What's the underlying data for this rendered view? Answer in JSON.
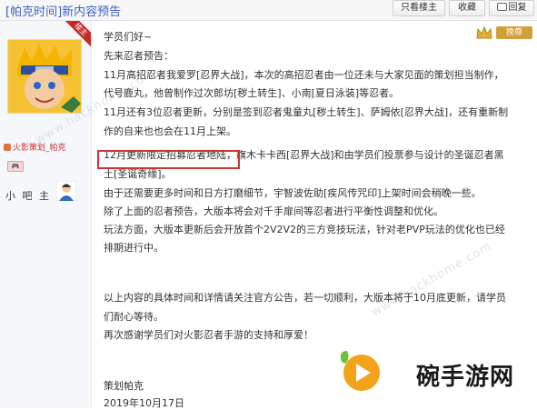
{
  "header": {
    "title": "[帕克时间]新内容预告",
    "only_op_label": "只看楼主",
    "favorite_label": "收藏",
    "reply_label": "回复"
  },
  "author": {
    "ribbon": "楼主",
    "name": "火影策划_帕克",
    "role": "小 吧 主"
  },
  "member_badge": "挽尊",
  "post": {
    "lines": [
      "学员们好~",
      "先来忍者预告：",
      "11月高招忍者我爱罗[忍界大战]，本次的高招忍者由一位还未与大家见面的策划担当制作，",
      "代号鹿丸，他曾制作过次郎坊[秽土转生]、小南[夏日泳装]等忍者。",
      "11月还有3位忍者更新，分别是签到忍者鬼童丸[秽土转生]、萨姆依[忍界大战]，还有重新制",
      "作的自来也也会在11月上架。",
      "12月更新限定招募忍者地陆，旗木卡卡西[忍界大战]和由学员们投票参与设计的圣诞忍者黑",
      "土[圣诞奇缘]。",
      "由于还需要更多时间和日方打磨细节，宇智波佐助[疾风传咒印]上架时间会稍晚一些。",
      "除了上面的忍者预告，大版本将会对千手扉间等忍者进行平衡性调整和优化。",
      "玩法方面，大版本更新后会开放首个2V2V2的三方竞技玩法，针对老PVP玩法的优化也已经",
      "排期进行中。",
      "以上内容的具体时间和详情请关注官方公告，若一切顺利，大版本将于10月底更新，请学员",
      "们耐心等待。",
      "再次感谢学员们对火影忍者手游的支持和厚爱！",
      "策划帕克",
      "2019年10月17日"
    ]
  },
  "watermark": "www.hackhome.com",
  "site_name": "碗手游网"
}
